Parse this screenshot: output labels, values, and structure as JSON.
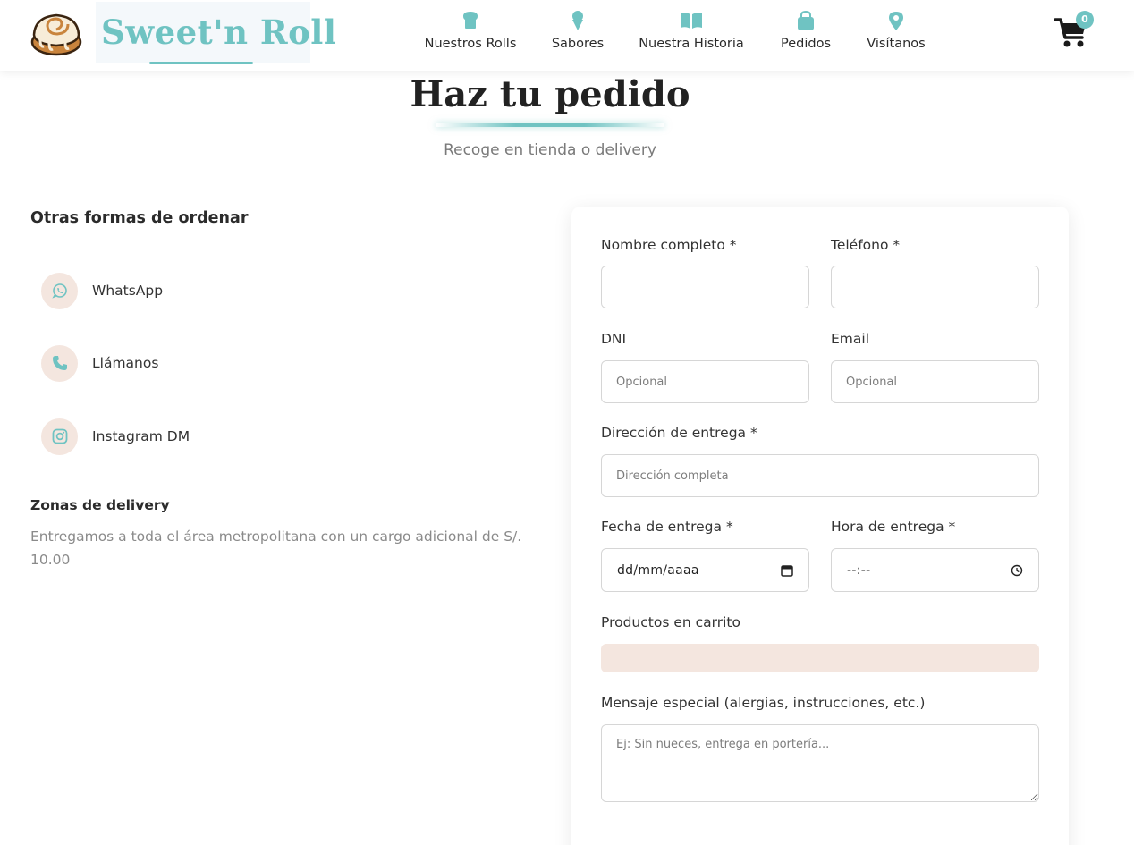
{
  "brand": {
    "name": "Sweet'n Roll",
    "logo_icon": "cinnamon-roll-icon"
  },
  "nav": {
    "items": [
      {
        "label": "Nuestros Rolls",
        "icon": "bread-icon"
      },
      {
        "label": "Sabores",
        "icon": "ice-cream-icon"
      },
      {
        "label": "Nuestra Historia",
        "icon": "book-icon"
      },
      {
        "label": "Pedidos",
        "icon": "shopping-bag-icon"
      },
      {
        "label": "Visítanos",
        "icon": "map-pin-icon"
      }
    ]
  },
  "cart": {
    "count": "0",
    "icon": "shopping-cart-icon"
  },
  "page": {
    "title": "Haz tu pedido",
    "subtitle": "Recoge en tienda o delivery"
  },
  "left": {
    "heading": "Otras formas de ordenar",
    "contacts": [
      {
        "label": "WhatsApp",
        "icon": "whatsapp-icon"
      },
      {
        "label": "Llámanos",
        "icon": "phone-icon"
      },
      {
        "label": "Instagram DM",
        "icon": "instagram-icon"
      }
    ],
    "zones_heading": "Zonas de delivery",
    "zones_text": "Entregamos a toda el área metropolitana con un cargo adicional de S/. 10.00"
  },
  "form": {
    "name_label": "Nombre completo *",
    "phone_label": "Teléfono *",
    "dni_label": "DNI",
    "dni_placeholder": "Opcional",
    "email_label": "Email",
    "email_placeholder": "Opcional",
    "address_label": "Dirección de entrega *",
    "address_placeholder": "Dirección completa",
    "date_label": "Fecha de entrega *",
    "date_value": "dd/mm/aaaa",
    "time_label": "Hora de entrega *",
    "time_value": "--:--",
    "cart_label": "Productos en carrito",
    "message_label": "Mensaje especial (alergias, instrucciones, etc.)",
    "message_placeholder": "Ej: Sin nueces, entrega en portería..."
  },
  "colors": {
    "accent": "#6fc3c2",
    "soft_peach": "#f4e6df",
    "text_muted": "#8a8a8a"
  }
}
